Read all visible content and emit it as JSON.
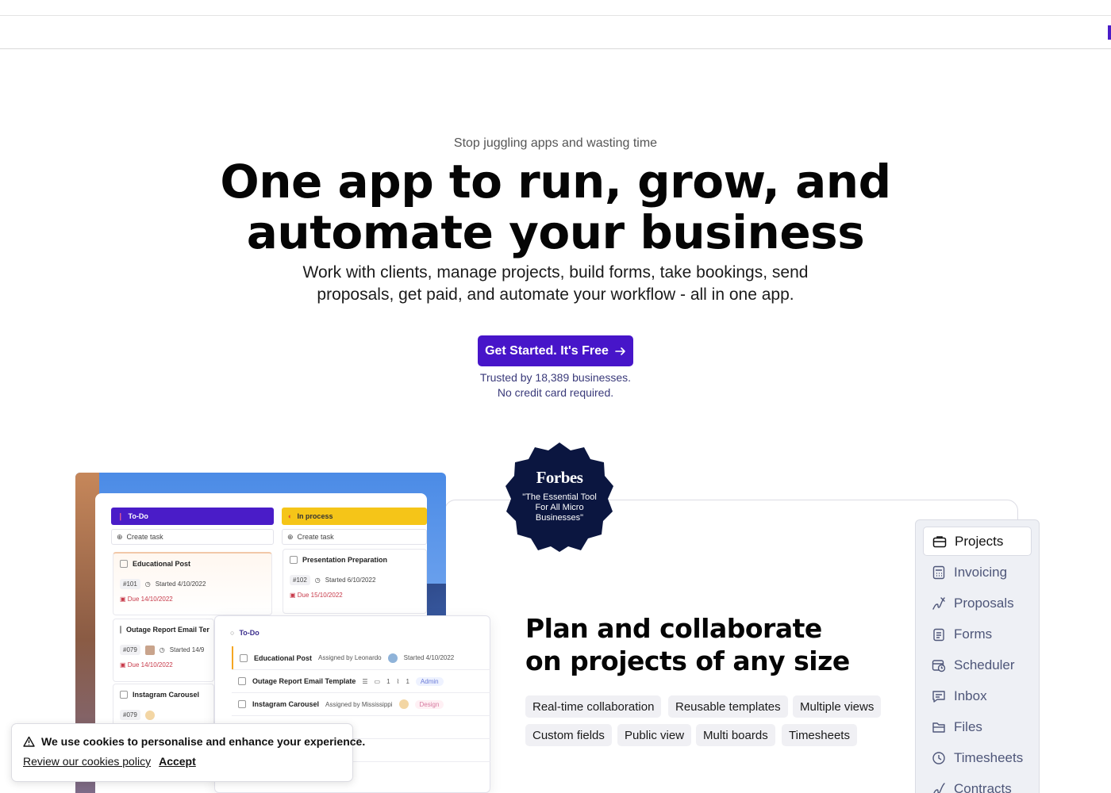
{
  "hero": {
    "eyebrow": "Stop juggling apps and wasting time",
    "headline_line1": "One app to run, grow, and",
    "headline_line2": "automate your business",
    "sub_line1": "Work with clients, manage projects, build forms, take bookings, send",
    "sub_line2": "proposals, get paid, and automate your workflow - all in one app.",
    "cta_label": "Get Started. It's Free",
    "trust_line1": "Trusted by 18,389 businesses.",
    "trust_line2": "No credit card required."
  },
  "badge": {
    "logo": "Forbes",
    "quote": "\"The Essential Tool For All Micro Businesses\""
  },
  "feature": {
    "title": "Plan and collaborate on projects of any size",
    "chips": [
      "Real-time collaboration",
      "Reusable templates",
      "Multiple views",
      "Custom fields",
      "Public view",
      "Multi boards",
      "Timesheets"
    ]
  },
  "sidenav": {
    "items": [
      {
        "label": "Projects",
        "icon": "briefcase-icon",
        "active": true
      },
      {
        "label": "Invoicing",
        "icon": "calculator-icon"
      },
      {
        "label": "Proposals",
        "icon": "pen-icon"
      },
      {
        "label": "Forms",
        "icon": "clipboard-icon"
      },
      {
        "label": "Scheduler",
        "icon": "calendar-clock-icon"
      },
      {
        "label": "Inbox",
        "icon": "chat-icon"
      },
      {
        "label": "Files",
        "icon": "folder-icon"
      },
      {
        "label": "Timesheets",
        "icon": "clock-icon"
      },
      {
        "label": "Contracts",
        "icon": "signature-icon"
      }
    ]
  },
  "board": {
    "col_todo": "To-Do",
    "col_process": "In process",
    "create_task": "Create task",
    "tasks": {
      "t1_title": "Educational Post",
      "t1_id": "#101",
      "t1_started": "Started 4/10/2022",
      "t1_due": "Due 14/10/2022",
      "t2_title": "Outage Report Email Ter",
      "t2_id": "#079",
      "t2_started": "Started 14/9",
      "t2_due": "Due 14/10/2022",
      "t3_title": "Instagram Carousel",
      "t3_id": "#079",
      "p1_title": "Presentation Preparation",
      "p1_id": "#102",
      "p1_started": "Started 6/10/2022",
      "p1_due": "Due 15/10/2022"
    },
    "list": {
      "head": "To-Do",
      "r1_title": "Educational Post",
      "r1_assign": "Assigned by Leonardo",
      "r1_started": "Started 4/10/2022",
      "r2_title": "Outage Report Email Template",
      "r2_c1": "1",
      "r2_c2": "1",
      "r2_tag": "Admin",
      "r3_title": "Instagram Carousel",
      "r3_assign": "Assigned by Mississippi",
      "r3_tag": "Design"
    }
  },
  "cookie": {
    "message": "We use cookies to personalise and enhance your experience.",
    "policy_link": "Review our cookies policy",
    "accept": "Accept"
  },
  "colors": {
    "brand": "#4715c9",
    "badge": "#0b1640",
    "due": "#c73a4a",
    "todo": "#4a1cc8",
    "process": "#f5c518"
  }
}
